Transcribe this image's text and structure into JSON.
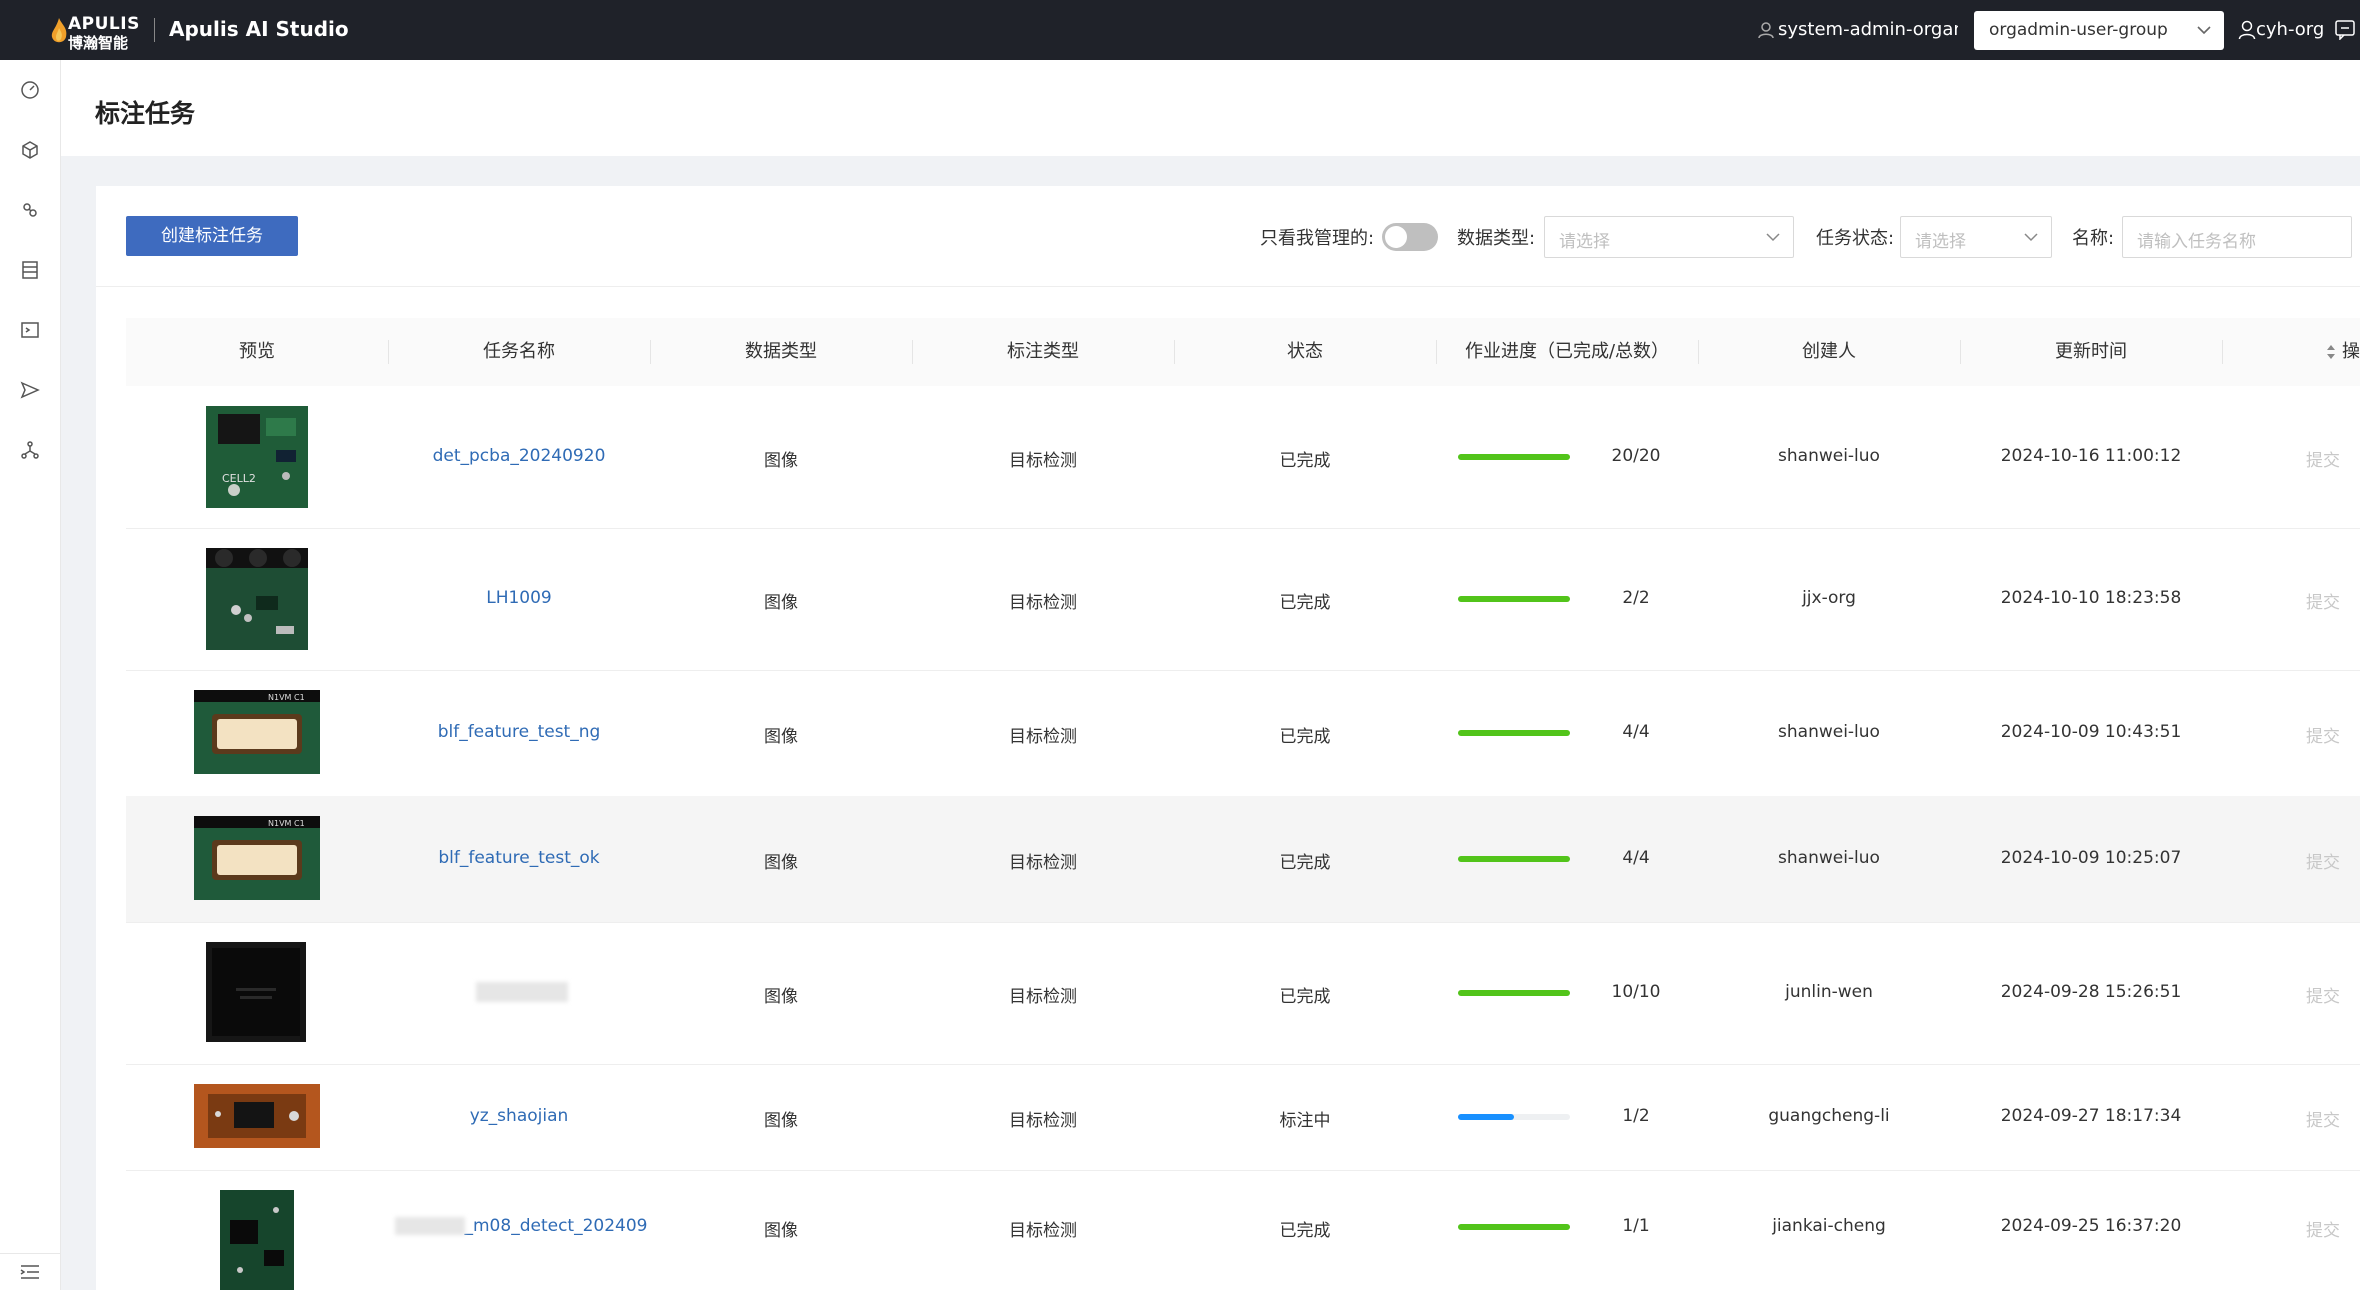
{
  "header": {
    "logo_en": "APULIS",
    "logo_cn": "博瀚智能",
    "app_name": "Apulis AI Studio",
    "admin_label": "system-admin-organ...",
    "group_select_value": "orgadmin-user-group",
    "org_name": "cyh-org"
  },
  "sidebar": {
    "icons": [
      "dashboard-icon",
      "model-cube-icon",
      "dataset-icon",
      "table-icon",
      "terminal-icon",
      "send-icon",
      "nodes-icon"
    ],
    "bottom_icon": "menu-collapse-icon"
  },
  "page": {
    "title": "标注任务"
  },
  "toolbar": {
    "create_label": "创建标注任务",
    "only_mine_label": "只看我管理的:",
    "only_mine_on": false,
    "data_type_label": "数据类型:",
    "data_type_placeholder": "请选择",
    "status_label": "任务状态:",
    "status_placeholder": "请选择",
    "name_label": "名称:",
    "name_placeholder": "请输入任务名称"
  },
  "table": {
    "headers": [
      "预览",
      "任务名称",
      "数据类型",
      "标注类型",
      "状态",
      "作业进度（已完成/总数）",
      "创建人",
      "更新时间",
      "操"
    ],
    "rows": [
      {
        "name": "det_pcba_20240920",
        "data_type": "图像",
        "label_type": "目标检测",
        "status": "已完成",
        "progress_text": "20/20",
        "progress": 1.0,
        "bar_color": "#52c41a",
        "creator": "shanwei-luo",
        "updated": "2024-10-16 11:00:12",
        "action": "提交",
        "thumb_text": "CELL2"
      },
      {
        "name": "LH1009",
        "data_type": "图像",
        "label_type": "目标检测",
        "status": "已完成",
        "progress_text": "2/2",
        "progress": 1.0,
        "bar_color": "#52c41a",
        "creator": "jjx-org",
        "updated": "2024-10-10 18:23:58",
        "action": "提交",
        "thumb_text": ""
      },
      {
        "name": "blf_feature_test_ng",
        "data_type": "图像",
        "label_type": "目标检测",
        "status": "已完成",
        "progress_text": "4/4",
        "progress": 1.0,
        "bar_color": "#52c41a",
        "creator": "shanwei-luo",
        "updated": "2024-10-09 10:43:51",
        "action": "提交",
        "thumb_text": "N1VM C1"
      },
      {
        "name": "blf_feature_test_ok",
        "data_type": "图像",
        "label_type": "目标检测",
        "status": "已完成",
        "progress_text": "4/4",
        "progress": 1.0,
        "bar_color": "#52c41a",
        "creator": "shanwei-luo",
        "updated": "2024-10-09 10:25:07",
        "action": "提交",
        "thumb_text": "N1VM C1"
      },
      {
        "name": "",
        "data_type": "图像",
        "label_type": "目标检测",
        "status": "已完成",
        "progress_text": "10/10",
        "progress": 1.0,
        "bar_color": "#52c41a",
        "creator": "junlin-wen",
        "updated": "2024-09-28 15:26:51",
        "action": "提交",
        "thumb_text": ""
      },
      {
        "name": "yz_shaojian",
        "data_type": "图像",
        "label_type": "目标检测",
        "status": "标注中",
        "progress_text": "1/2",
        "progress": 0.5,
        "bar_color": "#1890ff",
        "creator": "guangcheng-li",
        "updated": "2024-09-27 18:17:34",
        "action": "提交",
        "thumb_text": ""
      },
      {
        "name": "_m08_detect_202409",
        "data_type": "图像",
        "label_type": "目标检测",
        "status": "已完成",
        "progress_text": "1/1",
        "progress": 1.0,
        "bar_color": "#52c41a",
        "creator": "jiankai-cheng",
        "updated": "2024-09-25 16:37:20",
        "action": "提交",
        "thumb_text": ""
      }
    ]
  }
}
